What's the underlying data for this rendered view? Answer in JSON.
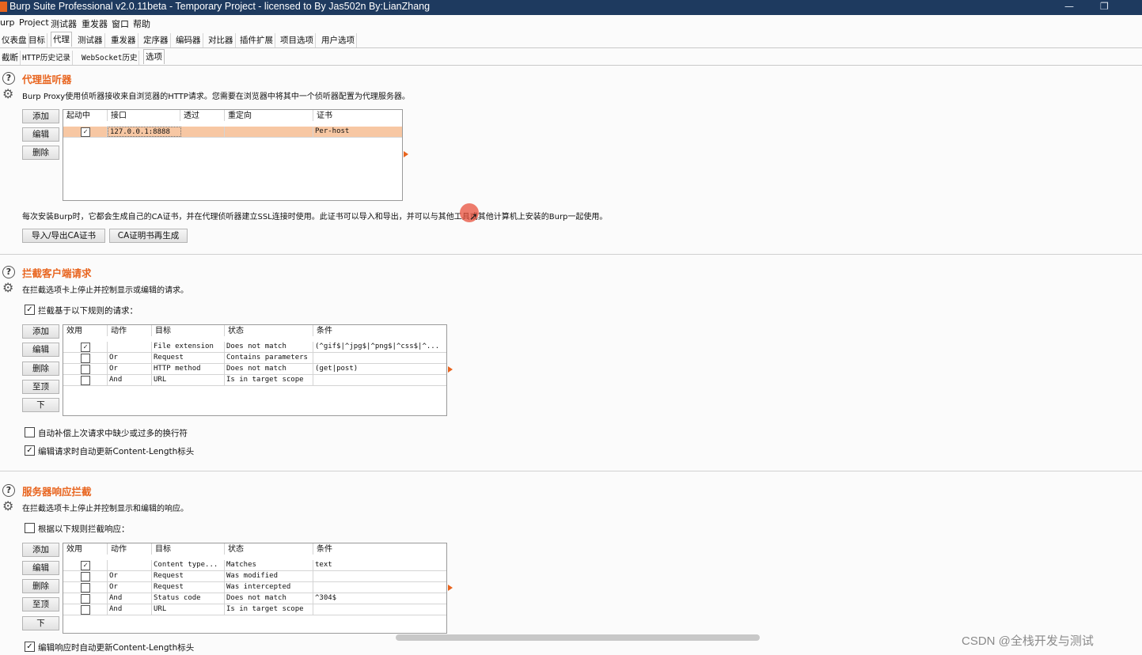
{
  "window": {
    "title": "Burp Suite Professional v2.0.11beta - Temporary Project - licensed to By Jas502n By:LianZhang",
    "minimize": "—",
    "restore": "❐",
    "close": "✕"
  },
  "menubar": [
    "urp",
    "Project",
    "测试器",
    "重发器",
    "窗口",
    "帮助"
  ],
  "main_tabs": [
    "仪表盘",
    "目标",
    "代理",
    "测试器",
    "重发器",
    "定序器",
    "编码器",
    "对比器",
    "插件扩展",
    "项目选项",
    "用户选项"
  ],
  "sub_tabs": [
    "截断",
    "HTTP历史记录",
    "WebSocket历史",
    "选项"
  ],
  "proxy_listeners": {
    "title": "代理监听器",
    "description": "Burp Proxy使用侦听器接收来自浏览器的HTTP请求。您需要在浏览器中将其中一个侦听器配置为代理服务器。",
    "buttons": {
      "add": "添加",
      "edit": "编辑",
      "remove": "删除"
    },
    "columns": [
      "起动中",
      "接口",
      "透过",
      "重定向",
      "证书"
    ],
    "rows": [
      {
        "running": true,
        "interface": "127.0.0.1:8888",
        "invisible": "",
        "redirect": "",
        "certificate": "Per-host"
      }
    ],
    "ca_note": "每次安装Burp时，它都会生成自己的CA证书，并在代理侦听器建立SSL连接时使用。此证书可以导入和导出，并可以与其他工具或其他计算机上安装的Burp一起使用。",
    "import_export_button": "导入/导出CA证书",
    "regenerate_button": "CA证明书再生成"
  },
  "client_intercept": {
    "title": "拦截客户端请求",
    "description": "在拦截选项卡上停止并控制显示或编辑的请求。",
    "intercept_checkbox": {
      "label": "拦截基于以下规则的请求：",
      "checked": true
    },
    "buttons": {
      "add": "添加",
      "edit": "编辑",
      "remove": "删除",
      "up": "至顶",
      "down": "下"
    },
    "columns": [
      "效用",
      "动作",
      "目标",
      "状态",
      "条件"
    ],
    "rows": [
      {
        "enabled": true,
        "op": "",
        "target": "File extension",
        "match": "Does not match",
        "condition": "(^gif$|^jpg$|^png$|^css$|^..."
      },
      {
        "enabled": false,
        "op": "Or",
        "target": "Request",
        "match": "Contains parameters",
        "condition": ""
      },
      {
        "enabled": false,
        "op": "Or",
        "target": "HTTP method",
        "match": "Does not match",
        "condition": "(get|post)"
      },
      {
        "enabled": false,
        "op": "And",
        "target": "URL",
        "match": "Is in target scope",
        "condition": ""
      }
    ],
    "option1": {
      "label": "自动补偿上次请求中缺少或过多的换行符",
      "checked": false
    },
    "option2": {
      "label": "编辑请求时自动更新Content-Length标头",
      "checked": true
    }
  },
  "server_intercept": {
    "title": "服务器响应拦截",
    "description": "在拦截选项卡上停止并控制显示和编辑的响应。",
    "intercept_checkbox": {
      "label": "根据以下规则拦截响应：",
      "checked": false
    },
    "buttons": {
      "add": "添加",
      "edit": "编辑",
      "remove": "删除",
      "up": "至顶",
      "down": "下"
    },
    "columns": [
      "效用",
      "动作",
      "目标",
      "状态",
      "条件"
    ],
    "rows": [
      {
        "enabled": true,
        "op": "",
        "target": "Content type...",
        "match": "Matches",
        "condition": "text"
      },
      {
        "enabled": false,
        "op": "Or",
        "target": "Request",
        "match": "Was modified",
        "condition": ""
      },
      {
        "enabled": false,
        "op": "Or",
        "target": "Request",
        "match": "Was intercepted",
        "condition": ""
      },
      {
        "enabled": false,
        "op": "And",
        "target": "Status code",
        "match": "Does not match",
        "condition": "^304$"
      },
      {
        "enabled": false,
        "op": "And",
        "target": "URL",
        "match": "Is in target scope",
        "condition": ""
      }
    ],
    "option1": {
      "label": "编辑响应时自动更新Content-Length标头",
      "checked": true
    }
  },
  "watermark": "CSDN @全栈开发与测试",
  "colors": {
    "accent": "#e8641e",
    "titlebar": "#1e3a5f",
    "selected_row": "#f7c7a3"
  }
}
